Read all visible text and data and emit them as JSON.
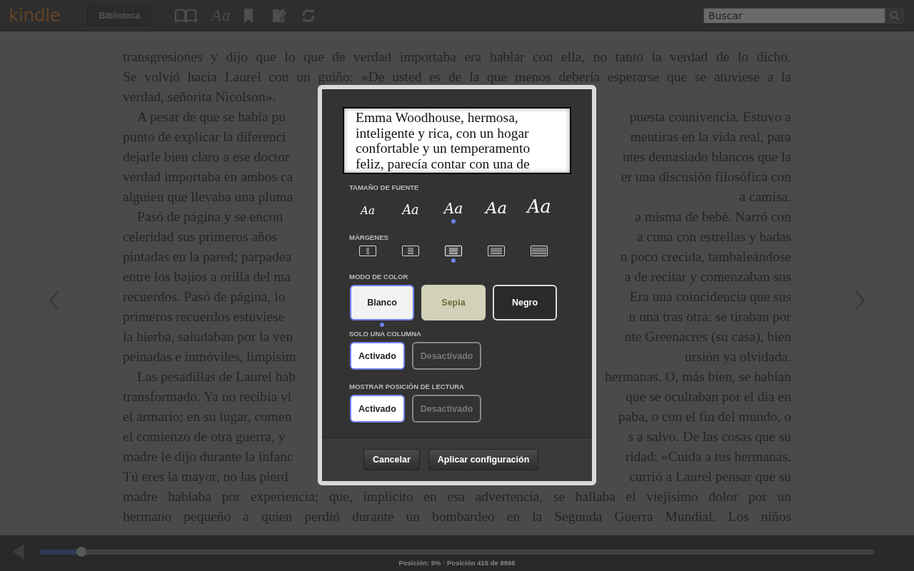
{
  "toolbar": {
    "logo": "kindle",
    "library_button": "Biblioteca",
    "font_button": "Aa",
    "search": {
      "placeholder": "Buscar"
    }
  },
  "page": {
    "lines": [
      {
        "kind": "full",
        "indent": false,
        "text": "transgresiones y dijo que lo que de verdad importaba era hablar con ella, no tanto la verdad de lo dicho."
      },
      {
        "kind": "full",
        "indent": false,
        "text": "Se volvió hacia Laurel con un guiño: «De usted es de la que menos debería esperarse que se atuviese a la"
      },
      {
        "kind": "left",
        "indent": false,
        "text": "verdad, señorita Nicolson»."
      },
      {
        "kind": "split",
        "indent": true,
        "left": "A pesar de que se había pu",
        "right": "puesta connivencia. Estuvo a"
      },
      {
        "kind": "split",
        "indent": false,
        "left": "punto de explicar la diferenci",
        "right": "mentiras en la vida real, para"
      },
      {
        "kind": "split",
        "indent": false,
        "left": "dejarle bien claro a ese doctor",
        "right": "ntes demasiado blancos que la"
      },
      {
        "kind": "split",
        "indent": false,
        "left": "verdad importaba en ambos ca",
        "right": "er una discusión filosófica con"
      },
      {
        "kind": "split",
        "indent": false,
        "left": "alguien que llevaba una pluma",
        "right": "a camisa."
      },
      {
        "kind": "split",
        "indent": true,
        "left": "Pasó de página y se encon",
        "right": "a misma de bebé. Narró con"
      },
      {
        "kind": "split",
        "indent": false,
        "left": "celeridad sus primeros años",
        "right": "a cuna con estrellas y hadas"
      },
      {
        "kind": "split",
        "indent": false,
        "left": "pintadas en la pared; parpadea",
        "right": "n poco crecida, tambaleándose"
      },
      {
        "kind": "split",
        "indent": false,
        "left": "entre los bajíos a orilla del ma",
        "right": "a de recitar y comenzaban sus"
      },
      {
        "kind": "split",
        "indent": false,
        "left": "recuerdos. Pasó de página, lo",
        "right": "Era una coincidencia que sus"
      },
      {
        "kind": "split",
        "indent": false,
        "left": "primeros recuerdos estuviese",
        "right": "n una tras otra: se tiraban por"
      },
      {
        "kind": "split",
        "indent": false,
        "left": "la hierba, saludaban por la ven",
        "right": "nte Greenacres (su casa), bien"
      },
      {
        "kind": "split",
        "indent": false,
        "left": "peinadas e inmóviles, limpísim",
        "right": "ursión ya olvidada."
      },
      {
        "kind": "split",
        "indent": true,
        "left": "Las pesadillas de Laurel hab",
        "right": "hermanas. O, más bien, se habían"
      },
      {
        "kind": "split",
        "indent": false,
        "left": "transformado. Ya no recibía vi",
        "right": "que se ocultaban por el día en"
      },
      {
        "kind": "split",
        "indent": false,
        "left": "el armario; en su lugar, comen",
        "right": "paba, o con el fin del mundo, o"
      },
      {
        "kind": "split",
        "indent": false,
        "left": "el comienzo de otra guerra, y",
        "right": "s a salvo. De las cosas que su"
      },
      {
        "kind": "split",
        "indent": false,
        "left": "madre le dijo durante la infanc",
        "right": "ridad: «Cuida a tus hermanas."
      },
      {
        "kind": "split",
        "indent": false,
        "left": "Tú eres la mayor, no las pierd",
        "right": "currió a Laurel pensar que su"
      },
      {
        "kind": "full",
        "indent": false,
        "text": "madre hablaba por experiencia; que, implícito en esa advertencia, se hallaba el viejísimo dolor por un"
      },
      {
        "kind": "full",
        "indent": false,
        "text": "hermano pequeño a quien perdió durante un bombardeo en la Segunda Guerra Mundial. Los niños"
      }
    ]
  },
  "dialog": {
    "preview": "Emma Woodhouse, hermosa, inteligente y rica, con un hogar confortable y un temperamento feliz, parecía contar con una de",
    "font_size": {
      "label": "TAMAÑO DE FUENTE",
      "options": [
        {
          "text": "Aa",
          "selected": false
        },
        {
          "text": "Aa",
          "selected": false
        },
        {
          "text": "Aa",
          "selected": true
        },
        {
          "text": "Aa",
          "selected": false
        },
        {
          "text": "Aa",
          "selected": false
        }
      ]
    },
    "margins": {
      "label": "MÁRGENES",
      "options": [
        {
          "selected": false
        },
        {
          "selected": false
        },
        {
          "selected": true
        },
        {
          "selected": false
        },
        {
          "selected": false
        }
      ]
    },
    "color_mode": {
      "label": "MODO DE COLOR",
      "options": [
        {
          "kind": "white",
          "label": "Blanco",
          "selected": true
        },
        {
          "kind": "sepia",
          "label": "Sepia",
          "selected": false
        },
        {
          "kind": "black",
          "label": "Negro",
          "selected": false
        }
      ]
    },
    "single_column": {
      "label": "SOLO UNA COLUMNA",
      "options": [
        {
          "label": "Activado",
          "selected": true
        },
        {
          "label": "Desactivado",
          "selected": false
        }
      ]
    },
    "reading_position": {
      "label": "MOSTRAR POSICIÓN DE LECTURA",
      "options": [
        {
          "label": "Activado",
          "selected": true
        },
        {
          "label": "Desactivado",
          "selected": false
        }
      ]
    },
    "buttons": [
      "Cancelar",
      "Aplicar configuración"
    ]
  },
  "footer": {
    "level": 0.05,
    "position": "Posición: 5% · Posición 415 de 8866"
  }
}
